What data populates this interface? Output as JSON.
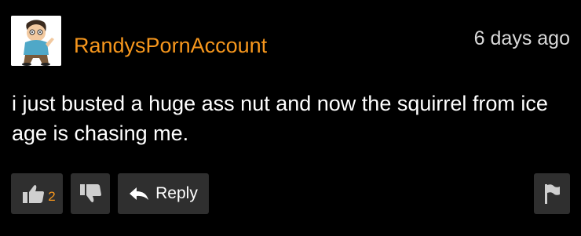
{
  "comment": {
    "username": "RandysPornAccount",
    "timestamp": "6 days ago",
    "text": "i just busted a huge ass nut and now the squirrel from ice age is chasing me.",
    "upvotes": "2",
    "reply_label": "Reply"
  },
  "icons": {
    "avatar": "cartoon-character-avatar",
    "thumbs_up": "thumbs-up-icon",
    "thumbs_down": "thumbs-down-icon",
    "reply": "reply-arrow-icon",
    "flag": "flag-icon"
  },
  "colors": {
    "background": "#000000",
    "username": "#f7971d",
    "vote_count": "#f7971d",
    "button_bg": "#2f2f2f",
    "text": "#ffffff",
    "timestamp": "#d9d9d9"
  }
}
